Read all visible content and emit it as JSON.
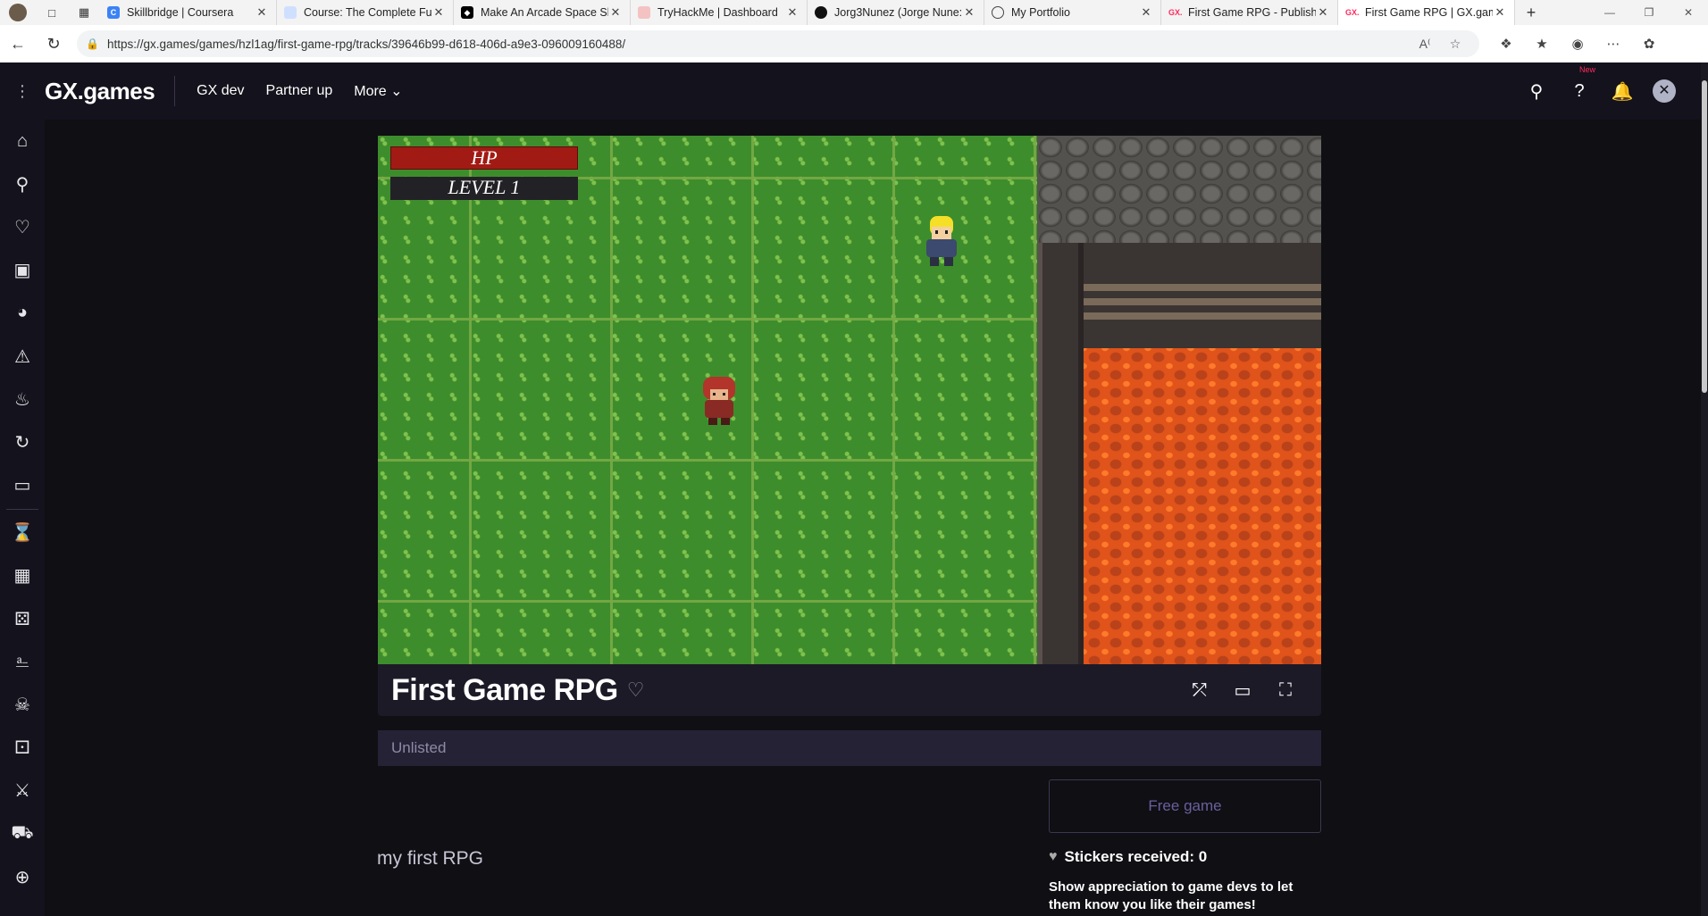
{
  "browser": {
    "tabs": [
      {
        "title": "Skillbridge | Coursera",
        "favicon": "coursera-icon"
      },
      {
        "title": "Course: The Complete Fu",
        "favicon": "course-icon"
      },
      {
        "title": "Make An Arcade Space Sh",
        "favicon": "unity-icon"
      },
      {
        "title": "TryHackMe | Dashboard",
        "favicon": "tryhackme-icon"
      },
      {
        "title": "Jorg3Nunez (Jorge Nune:",
        "favicon": "github-icon"
      },
      {
        "title": "My Portfolio",
        "favicon": "globe-icon"
      },
      {
        "title": "First Game RPG - Publish",
        "favicon": "gx-icon"
      },
      {
        "title": "First Game RPG | GX.gam",
        "favicon": "gx-icon"
      }
    ],
    "url": "https://gx.games/games/hzl1ag/first-game-rpg/tracks/39646b99-d618-406d-a9e3-096009160488/"
  },
  "header": {
    "logo": "GX.games",
    "nav": [
      "GX dev",
      "Partner up",
      "More"
    ],
    "new_badge": "New"
  },
  "game": {
    "hud": {
      "hp_label": "HP",
      "level_label": "LEVEL 1"
    },
    "title": "First Game RPG",
    "status": "Unlisted",
    "price_button": "Free game",
    "description": "my first RPG",
    "stickers_label": "Stickers received: 0",
    "appreciation": "Show appreciation to game devs to let them know you like their games!"
  },
  "colors": {
    "accent_pink": "#ff2a5f",
    "page_bg": "#0f0f14",
    "header_bg": "#14121c",
    "free_game_text": "#6a5f9c"
  }
}
